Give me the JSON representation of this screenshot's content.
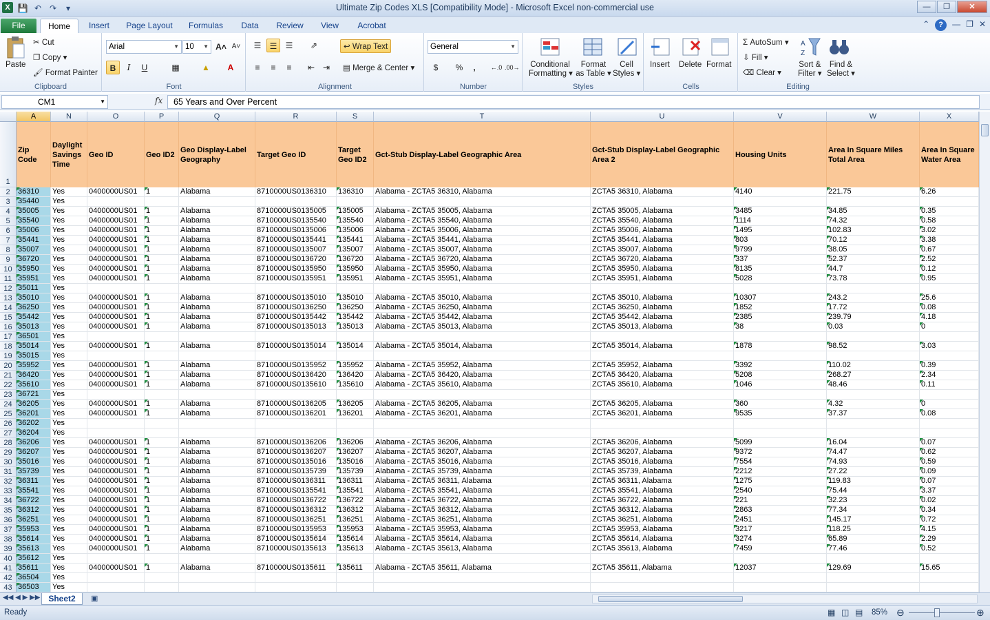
{
  "window": {
    "title": "Ultimate Zip Codes XLS  [Compatibility Mode]  -  Microsoft Excel non-commercial use",
    "app_icon_letter": "X"
  },
  "ribbon_tabs": [
    {
      "label": "File"
    },
    {
      "label": "Home"
    },
    {
      "label": "Insert"
    },
    {
      "label": "Page Layout"
    },
    {
      "label": "Formulas"
    },
    {
      "label": "Data"
    },
    {
      "label": "Review"
    },
    {
      "label": "View"
    },
    {
      "label": "Acrobat"
    }
  ],
  "clipboard": {
    "paste": "Paste",
    "cut": "Cut",
    "copy": "Copy",
    "format_painter": "Format Painter",
    "label": "Clipboard"
  },
  "font": {
    "name": "Arial",
    "size": "10",
    "label": "Font",
    "bold": "B",
    "italic": "I",
    "underline": "U"
  },
  "alignment": {
    "wrap_text": "Wrap Text",
    "merge_center": "Merge & Center",
    "label": "Alignment"
  },
  "number": {
    "format": "General",
    "label": "Number",
    "currency": "$",
    "percent": "%",
    "comma": ","
  },
  "styles": {
    "conditional": "Conditional",
    "conditional2": "Formatting",
    "format_table": "Format",
    "format_table2": "as Table",
    "cell_styles": "Cell",
    "cell_styles2": "Styles",
    "label": "Styles"
  },
  "cells": {
    "insert": "Insert",
    "delete": "Delete",
    "format": "Format",
    "label": "Cells"
  },
  "editing": {
    "autosum": "AutoSum",
    "fill": "Fill",
    "clear": "Clear",
    "sort": "Sort &",
    "sort2": "Filter",
    "find": "Find &",
    "find2": "Select",
    "label": "Editing"
  },
  "formula_bar": {
    "name_box": "CM1",
    "fx": "fx",
    "value": "65 Years and Over Percent"
  },
  "columns": [
    {
      "letter": "A",
      "header": "Zip Code"
    },
    {
      "letter": "N",
      "header": "Daylight Savings Time"
    },
    {
      "letter": "O",
      "header": "Geo ID"
    },
    {
      "letter": "P",
      "header": "Geo ID2"
    },
    {
      "letter": "Q",
      "header": "Geo Display-Label Geography"
    },
    {
      "letter": "R",
      "header": "Target Geo ID"
    },
    {
      "letter": "S",
      "header": "Target Geo ID2"
    },
    {
      "letter": "T",
      "header": "Gct-Stub Display-Label Geographic Area"
    },
    {
      "letter": "U",
      "header": "Gct-Stub Display-Label Geographic Area 2"
    },
    {
      "letter": "V",
      "header": "Housing Units"
    },
    {
      "letter": "W",
      "header": "Area In Square Miles Total Area"
    },
    {
      "letter": "X",
      "header": "Area In Square Water Area"
    }
  ],
  "header_row_number": "1",
  "rows": [
    {
      "n": "2",
      "zip": "36310",
      "dst": "Yes",
      "geo": "0400000US01",
      "geo2": "1",
      "disp": "Alabama",
      "tgeo": "8710000US0136310",
      "tgeo2": "136310",
      "area": "Alabama - ZCTA5 36310, Alabama",
      "area2": "ZCTA5 36310, Alabama",
      "hu": "4140",
      "tot": "221.75",
      "wat": "6.26"
    },
    {
      "n": "3",
      "zip": "35440",
      "dst": "Yes"
    },
    {
      "n": "4",
      "zip": "35005",
      "dst": "Yes",
      "geo": "0400000US01",
      "geo2": "1",
      "disp": "Alabama",
      "tgeo": "8710000US0135005",
      "tgeo2": "135005",
      "area": "Alabama - ZCTA5 35005, Alabama",
      "area2": "ZCTA5 35005, Alabama",
      "hu": "3485",
      "tot": "34.85",
      "wat": "0.35"
    },
    {
      "n": "5",
      "zip": "35540",
      "dst": "Yes",
      "geo": "0400000US01",
      "geo2": "1",
      "disp": "Alabama",
      "tgeo": "8710000US0135540",
      "tgeo2": "135540",
      "area": "Alabama - ZCTA5 35540, Alabama",
      "area2": "ZCTA5 35540, Alabama",
      "hu": "1114",
      "tot": "74.32",
      "wat": "0.58"
    },
    {
      "n": "6",
      "zip": "35006",
      "dst": "Yes",
      "geo": "0400000US01",
      "geo2": "1",
      "disp": "Alabama",
      "tgeo": "8710000US0135006",
      "tgeo2": "135006",
      "area": "Alabama - ZCTA5 35006, Alabama",
      "area2": "ZCTA5 35006, Alabama",
      "hu": "1495",
      "tot": "102.83",
      "wat": "3.02"
    },
    {
      "n": "7",
      "zip": "35441",
      "dst": "Yes",
      "geo": "0400000US01",
      "geo2": "1",
      "disp": "Alabama",
      "tgeo": "8710000US0135441",
      "tgeo2": "135441",
      "area": "Alabama - ZCTA5 35441, Alabama",
      "area2": "ZCTA5 35441, Alabama",
      "hu": "803",
      "tot": "70.12",
      "wat": "3.38"
    },
    {
      "n": "8",
      "zip": "35007",
      "dst": "Yes",
      "geo": "0400000US01",
      "geo2": "1",
      "disp": "Alabama",
      "tgeo": "8710000US0135007",
      "tgeo2": "135007",
      "area": "Alabama - ZCTA5 35007, Alabama",
      "area2": "ZCTA5 35007, Alabama",
      "hu": "9799",
      "tot": "38.05",
      "wat": "0.67"
    },
    {
      "n": "9",
      "zip": "36720",
      "dst": "Yes",
      "geo": "0400000US01",
      "geo2": "1",
      "disp": "Alabama",
      "tgeo": "8710000US0136720",
      "tgeo2": "136720",
      "area": "Alabama - ZCTA5 36720, Alabama",
      "area2": "ZCTA5 36720, Alabama",
      "hu": "337",
      "tot": "52.37",
      "wat": "2.52"
    },
    {
      "n": "10",
      "zip": "35950",
      "dst": "Yes",
      "geo": "0400000US01",
      "geo2": "1",
      "disp": "Alabama",
      "tgeo": "8710000US0135950",
      "tgeo2": "135950",
      "area": "Alabama - ZCTA5 35950, Alabama",
      "area2": "ZCTA5 35950, Alabama",
      "hu": "8135",
      "tot": "44.7",
      "wat": "0.12"
    },
    {
      "n": "11",
      "zip": "35951",
      "dst": "Yes",
      "geo": "0400000US01",
      "geo2": "1",
      "disp": "Alabama",
      "tgeo": "8710000US0135951",
      "tgeo2": "135951",
      "area": "Alabama - ZCTA5 35951, Alabama",
      "area2": "ZCTA5 35951, Alabama",
      "hu": "5028",
      "tot": "73.78",
      "wat": "0.95"
    },
    {
      "n": "12",
      "zip": "35011",
      "dst": "Yes"
    },
    {
      "n": "13",
      "zip": "35010",
      "dst": "Yes",
      "geo": "0400000US01",
      "geo2": "1",
      "disp": "Alabama",
      "tgeo": "8710000US0135010",
      "tgeo2": "135010",
      "area": "Alabama - ZCTA5 35010, Alabama",
      "area2": "ZCTA5 35010, Alabama",
      "hu": "10307",
      "tot": "243.2",
      "wat": "25.6"
    },
    {
      "n": "14",
      "zip": "36250",
      "dst": "Yes",
      "geo": "0400000US01",
      "geo2": "1",
      "disp": "Alabama",
      "tgeo": "8710000US0136250",
      "tgeo2": "136250",
      "area": "Alabama - ZCTA5 36250, Alabama",
      "area2": "ZCTA5 36250, Alabama",
      "hu": "1852",
      "tot": "17.72",
      "wat": "0.08"
    },
    {
      "n": "15",
      "zip": "35442",
      "dst": "Yes",
      "geo": "0400000US01",
      "geo2": "1",
      "disp": "Alabama",
      "tgeo": "8710000US0135442",
      "tgeo2": "135442",
      "area": "Alabama - ZCTA5 35442, Alabama",
      "area2": "ZCTA5 35442, Alabama",
      "hu": "2385",
      "tot": "239.79",
      "wat": "4.18"
    },
    {
      "n": "16",
      "zip": "35013",
      "dst": "Yes",
      "geo": "0400000US01",
      "geo2": "1",
      "disp": "Alabama",
      "tgeo": "8710000US0135013",
      "tgeo2": "135013",
      "area": "Alabama - ZCTA5 35013, Alabama",
      "area2": "ZCTA5 35013, Alabama",
      "hu": "38",
      "tot": "0.03",
      "wat": "0"
    },
    {
      "n": "17",
      "zip": "36501",
      "dst": "Yes"
    },
    {
      "n": "18",
      "zip": "35014",
      "dst": "Yes",
      "geo": "0400000US01",
      "geo2": "1",
      "disp": "Alabama",
      "tgeo": "8710000US0135014",
      "tgeo2": "135014",
      "area": "Alabama - ZCTA5 35014, Alabama",
      "area2": "ZCTA5 35014, Alabama",
      "hu": "1878",
      "tot": "98.52",
      "wat": "3.03"
    },
    {
      "n": "19",
      "zip": "35015",
      "dst": "Yes"
    },
    {
      "n": "20",
      "zip": "35952",
      "dst": "Yes",
      "geo": "0400000US01",
      "geo2": "1",
      "disp": "Alabama",
      "tgeo": "8710000US0135952",
      "tgeo2": "135952",
      "area": "Alabama - ZCTA5 35952, Alabama",
      "area2": "ZCTA5 35952, Alabama",
      "hu": "3392",
      "tot": "110.02",
      "wat": "0.39"
    },
    {
      "n": "21",
      "zip": "36420",
      "dst": "Yes",
      "geo": "0400000US01",
      "geo2": "1",
      "disp": "Alabama",
      "tgeo": "8710000US0136420",
      "tgeo2": "136420",
      "area": "Alabama - ZCTA5 36420, Alabama",
      "area2": "ZCTA5 36420, Alabama",
      "hu": "5208",
      "tot": "268.27",
      "wat": "2.34"
    },
    {
      "n": "22",
      "zip": "35610",
      "dst": "Yes",
      "geo": "0400000US01",
      "geo2": "1",
      "disp": "Alabama",
      "tgeo": "8710000US0135610",
      "tgeo2": "135610",
      "area": "Alabama - ZCTA5 35610, Alabama",
      "area2": "ZCTA5 35610, Alabama",
      "hu": "1046",
      "tot": "48.46",
      "wat": "0.11"
    },
    {
      "n": "23",
      "zip": "36721",
      "dst": "Yes"
    },
    {
      "n": "24",
      "zip": "36205",
      "dst": "Yes",
      "geo": "0400000US01",
      "geo2": "1",
      "disp": "Alabama",
      "tgeo": "8710000US0136205",
      "tgeo2": "136205",
      "area": "Alabama - ZCTA5 36205, Alabama",
      "area2": "ZCTA5 36205, Alabama",
      "hu": "360",
      "tot": "4.32",
      "wat": "0"
    },
    {
      "n": "25",
      "zip": "36201",
      "dst": "Yes",
      "geo": "0400000US01",
      "geo2": "1",
      "disp": "Alabama",
      "tgeo": "8710000US0136201",
      "tgeo2": "136201",
      "area": "Alabama - ZCTA5 36201, Alabama",
      "area2": "ZCTA5 36201, Alabama",
      "hu": "9535",
      "tot": "37.37",
      "wat": "0.08"
    },
    {
      "n": "26",
      "zip": "36202",
      "dst": "Yes"
    },
    {
      "n": "27",
      "zip": "36204",
      "dst": "Yes"
    },
    {
      "n": "28",
      "zip": "36206",
      "dst": "Yes",
      "geo": "0400000US01",
      "geo2": "1",
      "disp": "Alabama",
      "tgeo": "8710000US0136206",
      "tgeo2": "136206",
      "area": "Alabama - ZCTA5 36206, Alabama",
      "area2": "ZCTA5 36206, Alabama",
      "hu": "5099",
      "tot": "16.04",
      "wat": "0.07"
    },
    {
      "n": "29",
      "zip": "36207",
      "dst": "Yes",
      "geo": "0400000US01",
      "geo2": "1",
      "disp": "Alabama",
      "tgeo": "8710000US0136207",
      "tgeo2": "136207",
      "area": "Alabama - ZCTA5 36207, Alabama",
      "area2": "ZCTA5 36207, Alabama",
      "hu": "9372",
      "tot": "74.47",
      "wat": "0.62"
    },
    {
      "n": "30",
      "zip": "35016",
      "dst": "Yes",
      "geo": "0400000US01",
      "geo2": "1",
      "disp": "Alabama",
      "tgeo": "8710000US0135016",
      "tgeo2": "135016",
      "area": "Alabama - ZCTA5 35016, Alabama",
      "area2": "ZCTA5 35016, Alabama",
      "hu": "7554",
      "tot": "74.93",
      "wat": "0.59"
    },
    {
      "n": "31",
      "zip": "35739",
      "dst": "Yes",
      "geo": "0400000US01",
      "geo2": "1",
      "disp": "Alabama",
      "tgeo": "8710000US0135739",
      "tgeo2": "135739",
      "area": "Alabama - ZCTA5 35739, Alabama",
      "area2": "ZCTA5 35739, Alabama",
      "hu": "2212",
      "tot": "27.22",
      "wat": "0.09"
    },
    {
      "n": "32",
      "zip": "36311",
      "dst": "Yes",
      "geo": "0400000US01",
      "geo2": "1",
      "disp": "Alabama",
      "tgeo": "8710000US0136311",
      "tgeo2": "136311",
      "area": "Alabama - ZCTA5 36311, Alabama",
      "area2": "ZCTA5 36311, Alabama",
      "hu": "1275",
      "tot": "119.83",
      "wat": "0.07"
    },
    {
      "n": "33",
      "zip": "35541",
      "dst": "Yes",
      "geo": "0400000US01",
      "geo2": "1",
      "disp": "Alabama",
      "tgeo": "8710000US0135541",
      "tgeo2": "135541",
      "area": "Alabama - ZCTA5 35541, Alabama",
      "area2": "ZCTA5 35541, Alabama",
      "hu": "2540",
      "tot": "75.44",
      "wat": "3.37"
    },
    {
      "n": "34",
      "zip": "36722",
      "dst": "Yes",
      "geo": "0400000US01",
      "geo2": "1",
      "disp": "Alabama",
      "tgeo": "8710000US0136722",
      "tgeo2": "136722",
      "area": "Alabama - ZCTA5 36722, Alabama",
      "area2": "ZCTA5 36722, Alabama",
      "hu": "221",
      "tot": "32.23",
      "wat": "0.02"
    },
    {
      "n": "35",
      "zip": "36312",
      "dst": "Yes",
      "geo": "0400000US01",
      "geo2": "1",
      "disp": "Alabama",
      "tgeo": "8710000US0136312",
      "tgeo2": "136312",
      "area": "Alabama - ZCTA5 36312, Alabama",
      "area2": "ZCTA5 36312, Alabama",
      "hu": "2863",
      "tot": "77.34",
      "wat": "0.34"
    },
    {
      "n": "36",
      "zip": "36251",
      "dst": "Yes",
      "geo": "0400000US01",
      "geo2": "1",
      "disp": "Alabama",
      "tgeo": "8710000US0136251",
      "tgeo2": "136251",
      "area": "Alabama - ZCTA5 36251, Alabama",
      "area2": "ZCTA5 36251, Alabama",
      "hu": "2451",
      "tot": "145.17",
      "wat": "0.72"
    },
    {
      "n": "37",
      "zip": "35953",
      "dst": "Yes",
      "geo": "0400000US01",
      "geo2": "1",
      "disp": "Alabama",
      "tgeo": "8710000US0135953",
      "tgeo2": "135953",
      "area": "Alabama - ZCTA5 35953, Alabama",
      "area2": "ZCTA5 35953, Alabama",
      "hu": "3217",
      "tot": "118.25",
      "wat": "4.15"
    },
    {
      "n": "38",
      "zip": "35614",
      "dst": "Yes",
      "geo": "0400000US01",
      "geo2": "1",
      "disp": "Alabama",
      "tgeo": "8710000US0135614",
      "tgeo2": "135614",
      "area": "Alabama - ZCTA5 35614, Alabama",
      "area2": "ZCTA5 35614, Alabama",
      "hu": "3274",
      "tot": "65.89",
      "wat": "2.29"
    },
    {
      "n": "39",
      "zip": "35613",
      "dst": "Yes",
      "geo": "0400000US01",
      "geo2": "1",
      "disp": "Alabama",
      "tgeo": "8710000US0135613",
      "tgeo2": "135613",
      "area": "Alabama - ZCTA5 35613, Alabama",
      "area2": "ZCTA5 35613, Alabama",
      "hu": "7459",
      "tot": "77.46",
      "wat": "0.52"
    },
    {
      "n": "40",
      "zip": "35612",
      "dst": "Yes"
    },
    {
      "n": "41",
      "zip": "35611",
      "dst": "Yes",
      "geo": "0400000US01",
      "geo2": "1",
      "disp": "Alabama",
      "tgeo": "8710000US0135611",
      "tgeo2": "135611",
      "area": "Alabama - ZCTA5 35611, Alabama",
      "area2": "ZCTA5 35611, Alabama",
      "hu": "12037",
      "tot": "129.69",
      "wat": "15.65"
    },
    {
      "n": "42",
      "zip": "36504",
      "dst": "Yes"
    },
    {
      "n": "43",
      "zip": "36503",
      "dst": "Yes"
    }
  ],
  "sheet": {
    "tab": "Sheet2"
  },
  "status": {
    "ready": "Ready",
    "zoom": "85%"
  }
}
